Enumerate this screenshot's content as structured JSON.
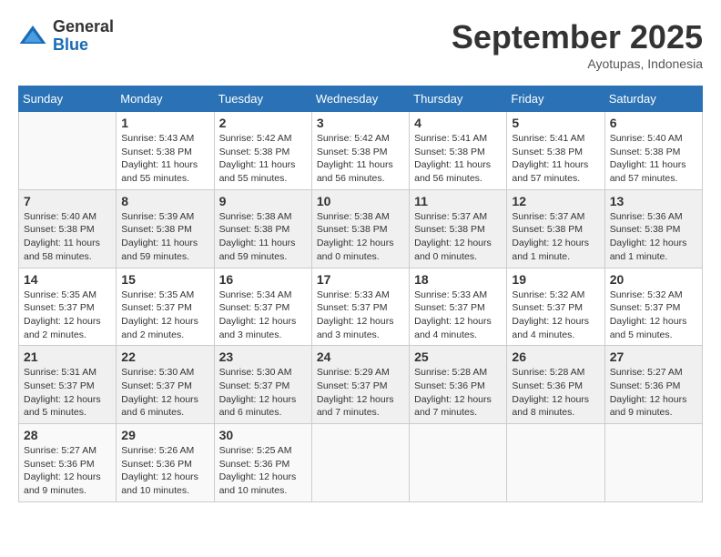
{
  "logo": {
    "general": "General",
    "blue": "Blue"
  },
  "header": {
    "month": "September 2025",
    "location": "Ayotupas, Indonesia"
  },
  "weekdays": [
    "Sunday",
    "Monday",
    "Tuesday",
    "Wednesday",
    "Thursday",
    "Friday",
    "Saturday"
  ],
  "weeks": [
    [
      {
        "day": "",
        "info": ""
      },
      {
        "day": "1",
        "info": "Sunrise: 5:43 AM\nSunset: 5:38 PM\nDaylight: 11 hours\nand 55 minutes."
      },
      {
        "day": "2",
        "info": "Sunrise: 5:42 AM\nSunset: 5:38 PM\nDaylight: 11 hours\nand 55 minutes."
      },
      {
        "day": "3",
        "info": "Sunrise: 5:42 AM\nSunset: 5:38 PM\nDaylight: 11 hours\nand 56 minutes."
      },
      {
        "day": "4",
        "info": "Sunrise: 5:41 AM\nSunset: 5:38 PM\nDaylight: 11 hours\nand 56 minutes."
      },
      {
        "day": "5",
        "info": "Sunrise: 5:41 AM\nSunset: 5:38 PM\nDaylight: 11 hours\nand 57 minutes."
      },
      {
        "day": "6",
        "info": "Sunrise: 5:40 AM\nSunset: 5:38 PM\nDaylight: 11 hours\nand 57 minutes."
      }
    ],
    [
      {
        "day": "7",
        "info": "Sunrise: 5:40 AM\nSunset: 5:38 PM\nDaylight: 11 hours\nand 58 minutes."
      },
      {
        "day": "8",
        "info": "Sunrise: 5:39 AM\nSunset: 5:38 PM\nDaylight: 11 hours\nand 59 minutes."
      },
      {
        "day": "9",
        "info": "Sunrise: 5:38 AM\nSunset: 5:38 PM\nDaylight: 11 hours\nand 59 minutes."
      },
      {
        "day": "10",
        "info": "Sunrise: 5:38 AM\nSunset: 5:38 PM\nDaylight: 12 hours\nand 0 minutes."
      },
      {
        "day": "11",
        "info": "Sunrise: 5:37 AM\nSunset: 5:38 PM\nDaylight: 12 hours\nand 0 minutes."
      },
      {
        "day": "12",
        "info": "Sunrise: 5:37 AM\nSunset: 5:38 PM\nDaylight: 12 hours\nand 1 minute."
      },
      {
        "day": "13",
        "info": "Sunrise: 5:36 AM\nSunset: 5:38 PM\nDaylight: 12 hours\nand 1 minute."
      }
    ],
    [
      {
        "day": "14",
        "info": "Sunrise: 5:35 AM\nSunset: 5:37 PM\nDaylight: 12 hours\nand 2 minutes."
      },
      {
        "day": "15",
        "info": "Sunrise: 5:35 AM\nSunset: 5:37 PM\nDaylight: 12 hours\nand 2 minutes."
      },
      {
        "day": "16",
        "info": "Sunrise: 5:34 AM\nSunset: 5:37 PM\nDaylight: 12 hours\nand 3 minutes."
      },
      {
        "day": "17",
        "info": "Sunrise: 5:33 AM\nSunset: 5:37 PM\nDaylight: 12 hours\nand 3 minutes."
      },
      {
        "day": "18",
        "info": "Sunrise: 5:33 AM\nSunset: 5:37 PM\nDaylight: 12 hours\nand 4 minutes."
      },
      {
        "day": "19",
        "info": "Sunrise: 5:32 AM\nSunset: 5:37 PM\nDaylight: 12 hours\nand 4 minutes."
      },
      {
        "day": "20",
        "info": "Sunrise: 5:32 AM\nSunset: 5:37 PM\nDaylight: 12 hours\nand 5 minutes."
      }
    ],
    [
      {
        "day": "21",
        "info": "Sunrise: 5:31 AM\nSunset: 5:37 PM\nDaylight: 12 hours\nand 5 minutes."
      },
      {
        "day": "22",
        "info": "Sunrise: 5:30 AM\nSunset: 5:37 PM\nDaylight: 12 hours\nand 6 minutes."
      },
      {
        "day": "23",
        "info": "Sunrise: 5:30 AM\nSunset: 5:37 PM\nDaylight: 12 hours\nand 6 minutes."
      },
      {
        "day": "24",
        "info": "Sunrise: 5:29 AM\nSunset: 5:37 PM\nDaylight: 12 hours\nand 7 minutes."
      },
      {
        "day": "25",
        "info": "Sunrise: 5:28 AM\nSunset: 5:36 PM\nDaylight: 12 hours\nand 7 minutes."
      },
      {
        "day": "26",
        "info": "Sunrise: 5:28 AM\nSunset: 5:36 PM\nDaylight: 12 hours\nand 8 minutes."
      },
      {
        "day": "27",
        "info": "Sunrise: 5:27 AM\nSunset: 5:36 PM\nDaylight: 12 hours\nand 9 minutes."
      }
    ],
    [
      {
        "day": "28",
        "info": "Sunrise: 5:27 AM\nSunset: 5:36 PM\nDaylight: 12 hours\nand 9 minutes."
      },
      {
        "day": "29",
        "info": "Sunrise: 5:26 AM\nSunset: 5:36 PM\nDaylight: 12 hours\nand 10 minutes."
      },
      {
        "day": "30",
        "info": "Sunrise: 5:25 AM\nSunset: 5:36 PM\nDaylight: 12 hours\nand 10 minutes."
      },
      {
        "day": "",
        "info": ""
      },
      {
        "day": "",
        "info": ""
      },
      {
        "day": "",
        "info": ""
      },
      {
        "day": "",
        "info": ""
      }
    ]
  ]
}
